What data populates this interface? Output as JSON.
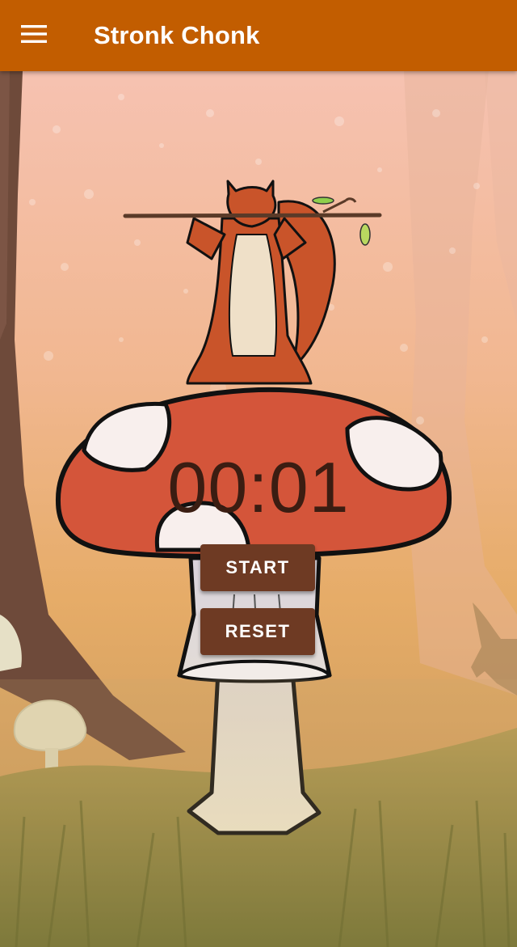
{
  "app_bar": {
    "title": "Stronk Chonk",
    "menu_icon": "hamburger-menu-icon",
    "background_color": "#c25d00"
  },
  "timer": {
    "display": "00:01"
  },
  "controls": {
    "start_label": "START",
    "reset_label": "RESET",
    "button_color": "#6e3a23"
  },
  "illustration": {
    "subject": "squirrel-lifting-barbell-on-mushroom",
    "mushroom_cap_color": "#d4553a"
  }
}
